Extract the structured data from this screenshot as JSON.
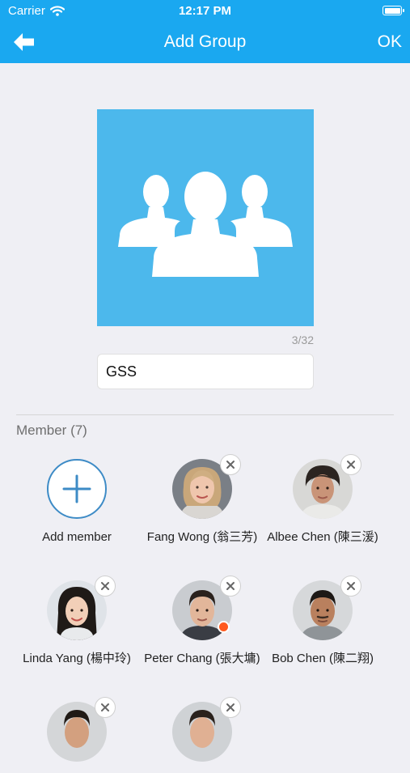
{
  "status_bar": {
    "carrier": "Carrier",
    "time": "12:17 PM"
  },
  "nav": {
    "title": "Add Group",
    "ok_label": "OK",
    "back_icon": "arrow-left-icon"
  },
  "group": {
    "name_value": "GSS",
    "char_counter": "3/32",
    "photo_icon": "group-people-icon"
  },
  "members": {
    "header": "Member (7)",
    "add_label": "Add member",
    "list": [
      {
        "name": "Fang Wong (翁三芳)",
        "online": false
      },
      {
        "name": "Albee Chen (陳三湲)",
        "online": false
      },
      {
        "name": "Linda Yang (楊中玲)",
        "online": false
      },
      {
        "name": "Peter Chang (張大墉)",
        "online": true
      },
      {
        "name": "Bob Chen (陳二翔)",
        "online": false
      },
      {
        "name": "",
        "online": false
      },
      {
        "name": "",
        "online": false
      }
    ]
  },
  "colors": {
    "accent": "#1aa8f0",
    "photo_bg": "#4cb8ec",
    "add_ring": "#3d8bc6",
    "online_dot": "#ff5a1f"
  }
}
